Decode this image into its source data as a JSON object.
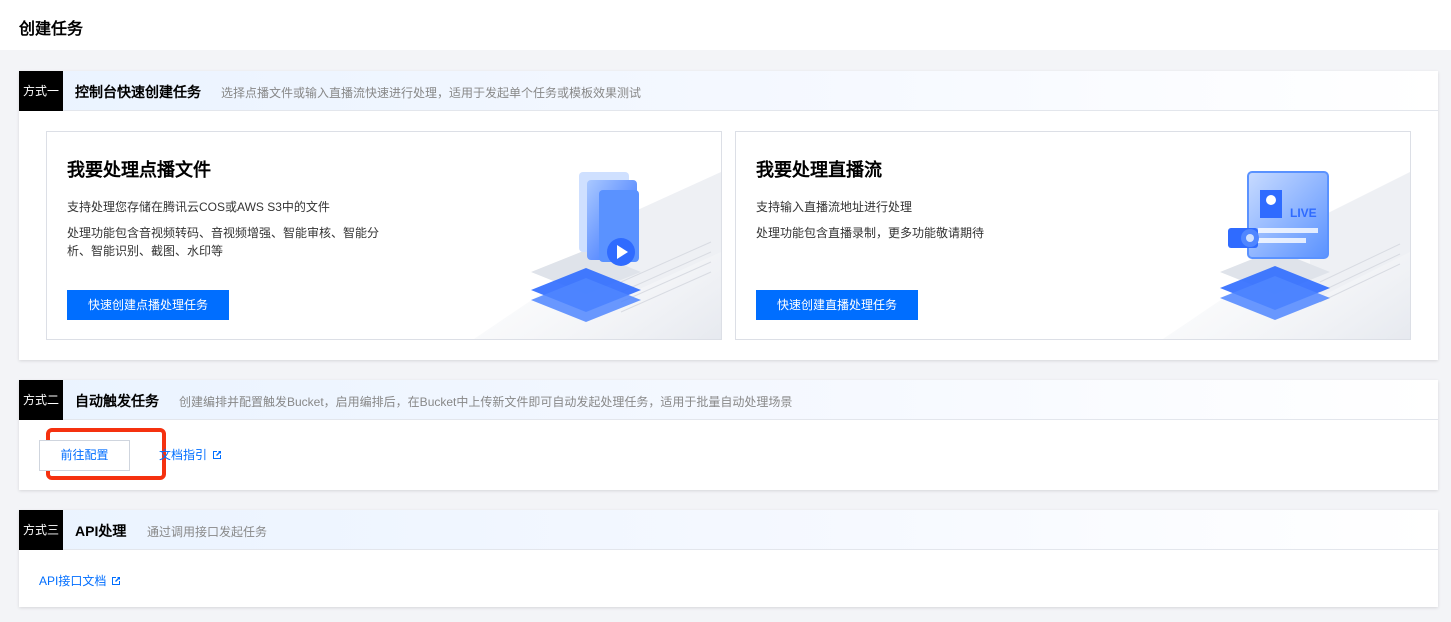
{
  "page": {
    "title": "创建任务"
  },
  "method1": {
    "tag": "方式一",
    "title": "控制台快速创建任务",
    "desc": "选择点播文件或输入直播流快速进行处理，适用于发起单个任务或模板效果测试",
    "vod": {
      "title": "我要处理点播文件",
      "line1": "支持处理您存储在腾讯云COS或AWS S3中的文件",
      "line2": "处理功能包含音视频转码、音视频增强、智能审核、智能分析、智能识别、截图、水印等",
      "button": "快速创建点播处理任务",
      "illustration": "folder-video-illustration"
    },
    "live": {
      "title": "我要处理直播流",
      "line1": "支持输入直播流地址进行处理",
      "line2": "处理功能包含直播录制，更多功能敬请期待",
      "button": "快速创建直播处理任务",
      "illustration": "live-stream-illustration",
      "live_badge": "LIVE"
    }
  },
  "method2": {
    "tag": "方式二",
    "title": "自动触发任务",
    "desc": "创建编排并配置触发Bucket，启用编排后，在Bucket中上传新文件即可自动发起处理任务，适用于批量自动处理场景",
    "goto_button": "前往配置",
    "doc_link": "文档指引",
    "highlight_color": "#f5310f"
  },
  "method3": {
    "tag": "方式三",
    "title": "API处理",
    "desc": "通过调用接口发起任务",
    "api_link": "API接口文档"
  },
  "colors": {
    "primary": "#006eff",
    "tag_bg": "#000000",
    "highlight": "#f5310f"
  }
}
